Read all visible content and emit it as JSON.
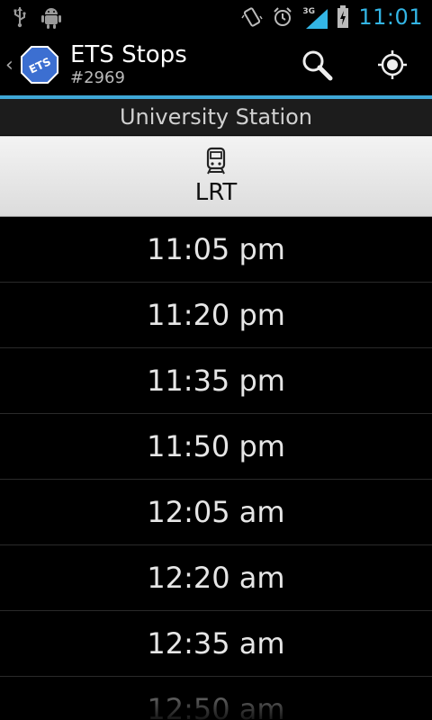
{
  "status_bar": {
    "time": "11:01",
    "network": "3G",
    "icons": [
      "usb-icon",
      "android-debug-icon",
      "vibrate-icon",
      "alarm-icon",
      "signal-icon",
      "battery-charging-icon"
    ],
    "accent_color": "#33b5e5"
  },
  "action_bar": {
    "up_icon": "chevron-left-icon",
    "logo_text": "ETS",
    "title": "ETS Stops",
    "subtitle": "#2969",
    "actions": [
      {
        "name": "search-icon"
      },
      {
        "name": "location-icon"
      }
    ],
    "divider_color": "#3fa7d6"
  },
  "station": {
    "name": "University Station"
  },
  "route": {
    "icon": "train-icon",
    "label": "LRT"
  },
  "times": [
    "11:05 pm",
    "11:20 pm",
    "11:35 pm",
    "11:50 pm",
    "12:05 am",
    "12:20 am",
    "12:35 am",
    "12:50 am"
  ]
}
